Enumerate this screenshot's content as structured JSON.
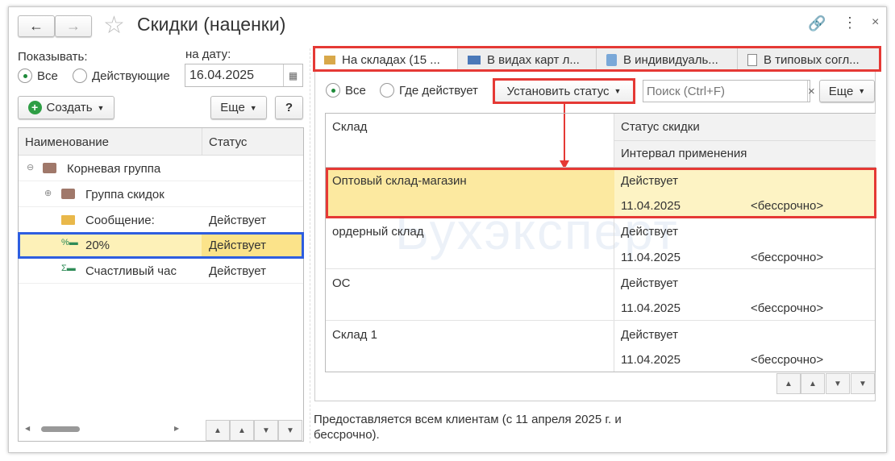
{
  "window": {
    "title": "Скидки (наценки)",
    "watermark": "Бухэксперт"
  },
  "left": {
    "show_label": "Показывать:",
    "radio_all": "Все",
    "radio_active": "Действующие",
    "date_label": "на дату:",
    "date_value": "16.04.2025",
    "create_label": "Создать",
    "more_label": "Еще",
    "help_label": "?",
    "columns": [
      "Наименование",
      "Статус"
    ],
    "rows": [
      {
        "name": "Корневая группа",
        "status": "",
        "icon": "folder-icon"
      },
      {
        "name": "Группа скидок",
        "status": "",
        "icon": "folder-icon"
      },
      {
        "name": "Сообщение:",
        "status": "Действует",
        "icon": "envelope-icon"
      },
      {
        "name": "20%",
        "status": "Действует",
        "icon": "percent-discount-icon"
      },
      {
        "name": "Счастливый час",
        "status": "Действует",
        "icon": "sum-discount-icon"
      }
    ]
  },
  "right": {
    "tabs": [
      "На складах (15 ...",
      "В видах карт л...",
      "В индивидуаль...",
      "В типовых согл..."
    ],
    "radio_all": "Все",
    "radio_where": "Где действует",
    "set_status_label": "Установить статус",
    "search_placeholder": "Поиск (Ctrl+F)",
    "more_label": "Еще",
    "columns": {
      "warehouse": "Склад",
      "status": "Статус скидки",
      "interval": "Интервал применения"
    },
    "rows": [
      {
        "warehouse": "Оптовый склад-магазин",
        "status": "Действует",
        "from": "11.04.2025",
        "to": "<бессрочно>"
      },
      {
        "warehouse": "ордерный склад",
        "status": "Действует",
        "from": "11.04.2025",
        "to": "<бессрочно>"
      },
      {
        "warehouse": "ОС",
        "status": "Действует",
        "from": "11.04.2025",
        "to": "<бессрочно>"
      },
      {
        "warehouse": "Склад 1",
        "status": "Действует",
        "from": "11.04.2025",
        "to": "<бессрочно>"
      }
    ],
    "description": "Предоставляется всем клиентам (с 11 апреля 2025 г. и бессрочно)."
  }
}
